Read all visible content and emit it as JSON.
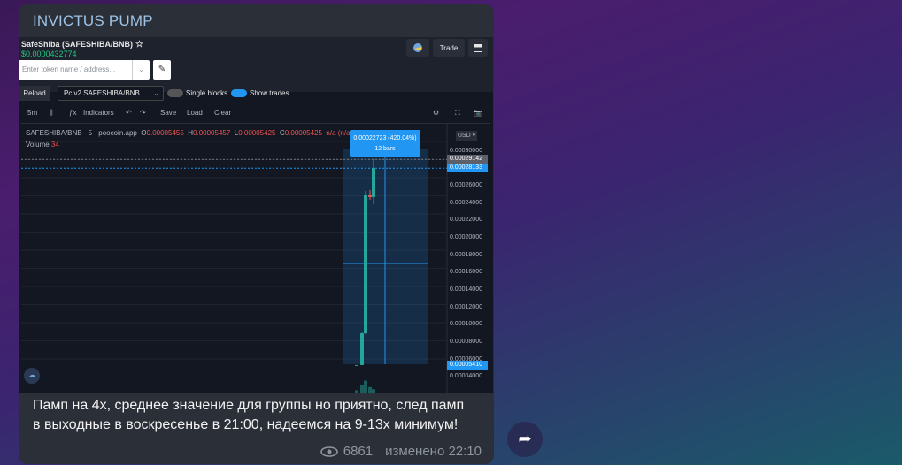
{
  "channel": {
    "name": "INVICTUS PUMP"
  },
  "screenshot": {
    "token_name": "SafeShiba (SAFESHIBA/BNB)",
    "token_price": "$0.0000432774",
    "header_buttons": {
      "trade": "Trade"
    },
    "search": {
      "placeholder": "Enter token name / address..."
    },
    "reload_label": "Reload",
    "pair_select": "Pc v2 SAFESHIBA/BNB",
    "single_blocks_label": "Single blocks",
    "show_trades_label": "Show trades",
    "chart_toolbar": {
      "interval": "5m",
      "indicators": "Indicators",
      "save": "Save",
      "load": "Load",
      "clear": "Clear"
    },
    "ohlc": {
      "symbol": "SAFESHIBA/BNB · 5 · poocoin.app",
      "o_label": "O",
      "o": "0.00005455",
      "h_label": "H",
      "h": "0.00005457",
      "l_label": "L",
      "l": "0.00005425",
      "c_label": "C",
      "c": "0.00005425",
      "extra": "n/a (n/a)"
    },
    "volume": {
      "label": "Volume",
      "value": "34"
    },
    "currency": "USD ▾",
    "measure": {
      "line1": "0.00022723 (420.04%)",
      "line2": "12 bars"
    },
    "y_ticks": [
      "0.00030000",
      "0.00026000",
      "0.00024000",
      "0.00022000",
      "0.00020000",
      "0.00018000",
      "0.00016000",
      "0.00014000",
      "0.00012000",
      "0.00010000",
      "0.00008000",
      "0.00006000",
      "0.00004000"
    ],
    "price_markers": {
      "top": "0.00029142",
      "current": "0.00028133",
      "base": "0.00005410"
    },
    "colors": {
      "up": "#26a69a",
      "measure": "#2196f3",
      "price_text": "#26c281"
    }
  },
  "chart_data": {
    "type": "candlestick",
    "ylim": [
      3e-05,
      0.00031
    ],
    "candles": [
      {
        "o": 5.43e-05,
        "h": 5.46e-05,
        "l": 5.4e-05,
        "c": 5.45e-05
      },
      {
        "o": 5.45e-05,
        "h": 9.2e-05,
        "l": 5.45e-05,
        "c": 9.1e-05
      },
      {
        "o": 9.1e-05,
        "h": 0.000255,
        "l": 9e-05,
        "c": 0.00025
      },
      {
        "o": 0.00025,
        "h": 0.000256,
        "l": 0.000245,
        "c": 0.000248
      },
      {
        "o": 0.000248,
        "h": 0.000291,
        "l": 0.00024,
        "c": 0.0002813
      }
    ],
    "volume": [
      3,
      8,
      12,
      6,
      4
    ]
  },
  "message": {
    "text": "Памп на 4х, среднее значение для группы но приятно, след памп в выходные в воскресенье в 21:00, надеемся на 9-13х минимум!",
    "views": "6861",
    "edited": "изменено 22:10"
  }
}
